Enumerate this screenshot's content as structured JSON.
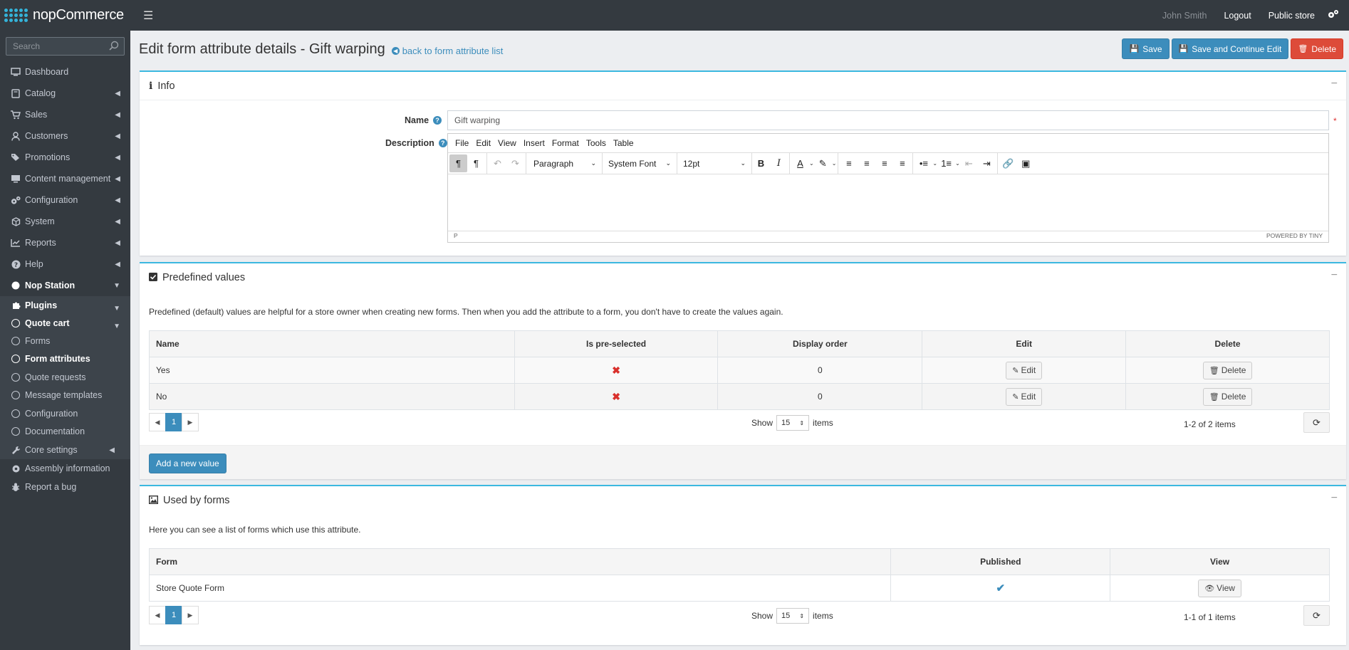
{
  "header": {
    "brand": "nopCommerce",
    "user": "John Smith",
    "logout": "Logout",
    "public_store": "Public store"
  },
  "sidebar": {
    "search_placeholder": "Search",
    "items": [
      {
        "label": "Dashboard",
        "icon": "monitor-icon"
      },
      {
        "label": "Catalog",
        "icon": "book-icon"
      },
      {
        "label": "Sales",
        "icon": "cart-icon"
      },
      {
        "label": "Customers",
        "icon": "user-icon"
      },
      {
        "label": "Promotions",
        "icon": "tags-icon"
      },
      {
        "label": "Content management",
        "icon": "desktop-icon"
      },
      {
        "label": "Configuration",
        "icon": "gears-icon"
      },
      {
        "label": "System",
        "icon": "cube-icon"
      },
      {
        "label": "Reports",
        "icon": "chart-icon"
      },
      {
        "label": "Help",
        "icon": "question-icon"
      },
      {
        "label": "Nop Station",
        "icon": "circle-icon"
      },
      {
        "label": "Plugins",
        "icon": "puzzle-icon"
      },
      {
        "label": "Quote cart",
        "icon": "circle-outline-icon"
      }
    ],
    "quote_sub": [
      "Forms",
      "Form attributes",
      "Quote requests",
      "Message templates",
      "Configuration",
      "Documentation"
    ],
    "bottom": [
      {
        "label": "Core settings",
        "icon": "wrench-icon"
      },
      {
        "label": "Assembly information",
        "icon": "gear-icon"
      },
      {
        "label": "Report a bug",
        "icon": "bug-icon"
      }
    ]
  },
  "page": {
    "title": "Edit form attribute details - Gift warping",
    "back_link": "back to form attribute list",
    "save": "Save",
    "save_continue": "Save and Continue Edit",
    "delete": "Delete"
  },
  "info": {
    "title": "Info",
    "name_label": "Name",
    "name_value": "Gift warping",
    "description_label": "Description",
    "editor_menu": [
      "File",
      "Edit",
      "View",
      "Insert",
      "Format",
      "Tools",
      "Table"
    ],
    "block_format": "Paragraph",
    "font_family": "System Font",
    "font_size": "12pt",
    "status_path": "P",
    "powered_by": "POWERED BY TINY"
  },
  "predefined": {
    "title": "Predefined values",
    "description": "Predefined (default) values are helpful for a store owner when creating new forms. Then when you add the attribute to a form, you don't have to create the values again.",
    "columns": [
      "Name",
      "Is pre-selected",
      "Display order",
      "Edit",
      "Delete"
    ],
    "rows": [
      {
        "name": "Yes",
        "order": "0",
        "edit": "Edit",
        "delete": "Delete"
      },
      {
        "name": "No",
        "order": "0",
        "edit": "Edit",
        "delete": "Delete"
      }
    ],
    "page": "1",
    "show": "Show",
    "page_size": "15",
    "items": "items",
    "info": "1-2 of 2 items",
    "add_button": "Add a new value"
  },
  "used_by": {
    "title": "Used by forms",
    "description": "Here you can see a list of forms which use this attribute.",
    "columns": [
      "Form",
      "Published",
      "View"
    ],
    "rows": [
      {
        "form": "Store Quote Form",
        "view": "View"
      }
    ],
    "page": "1",
    "show": "Show",
    "page_size": "15",
    "items": "items",
    "info": "1-1 of 1 items"
  }
}
